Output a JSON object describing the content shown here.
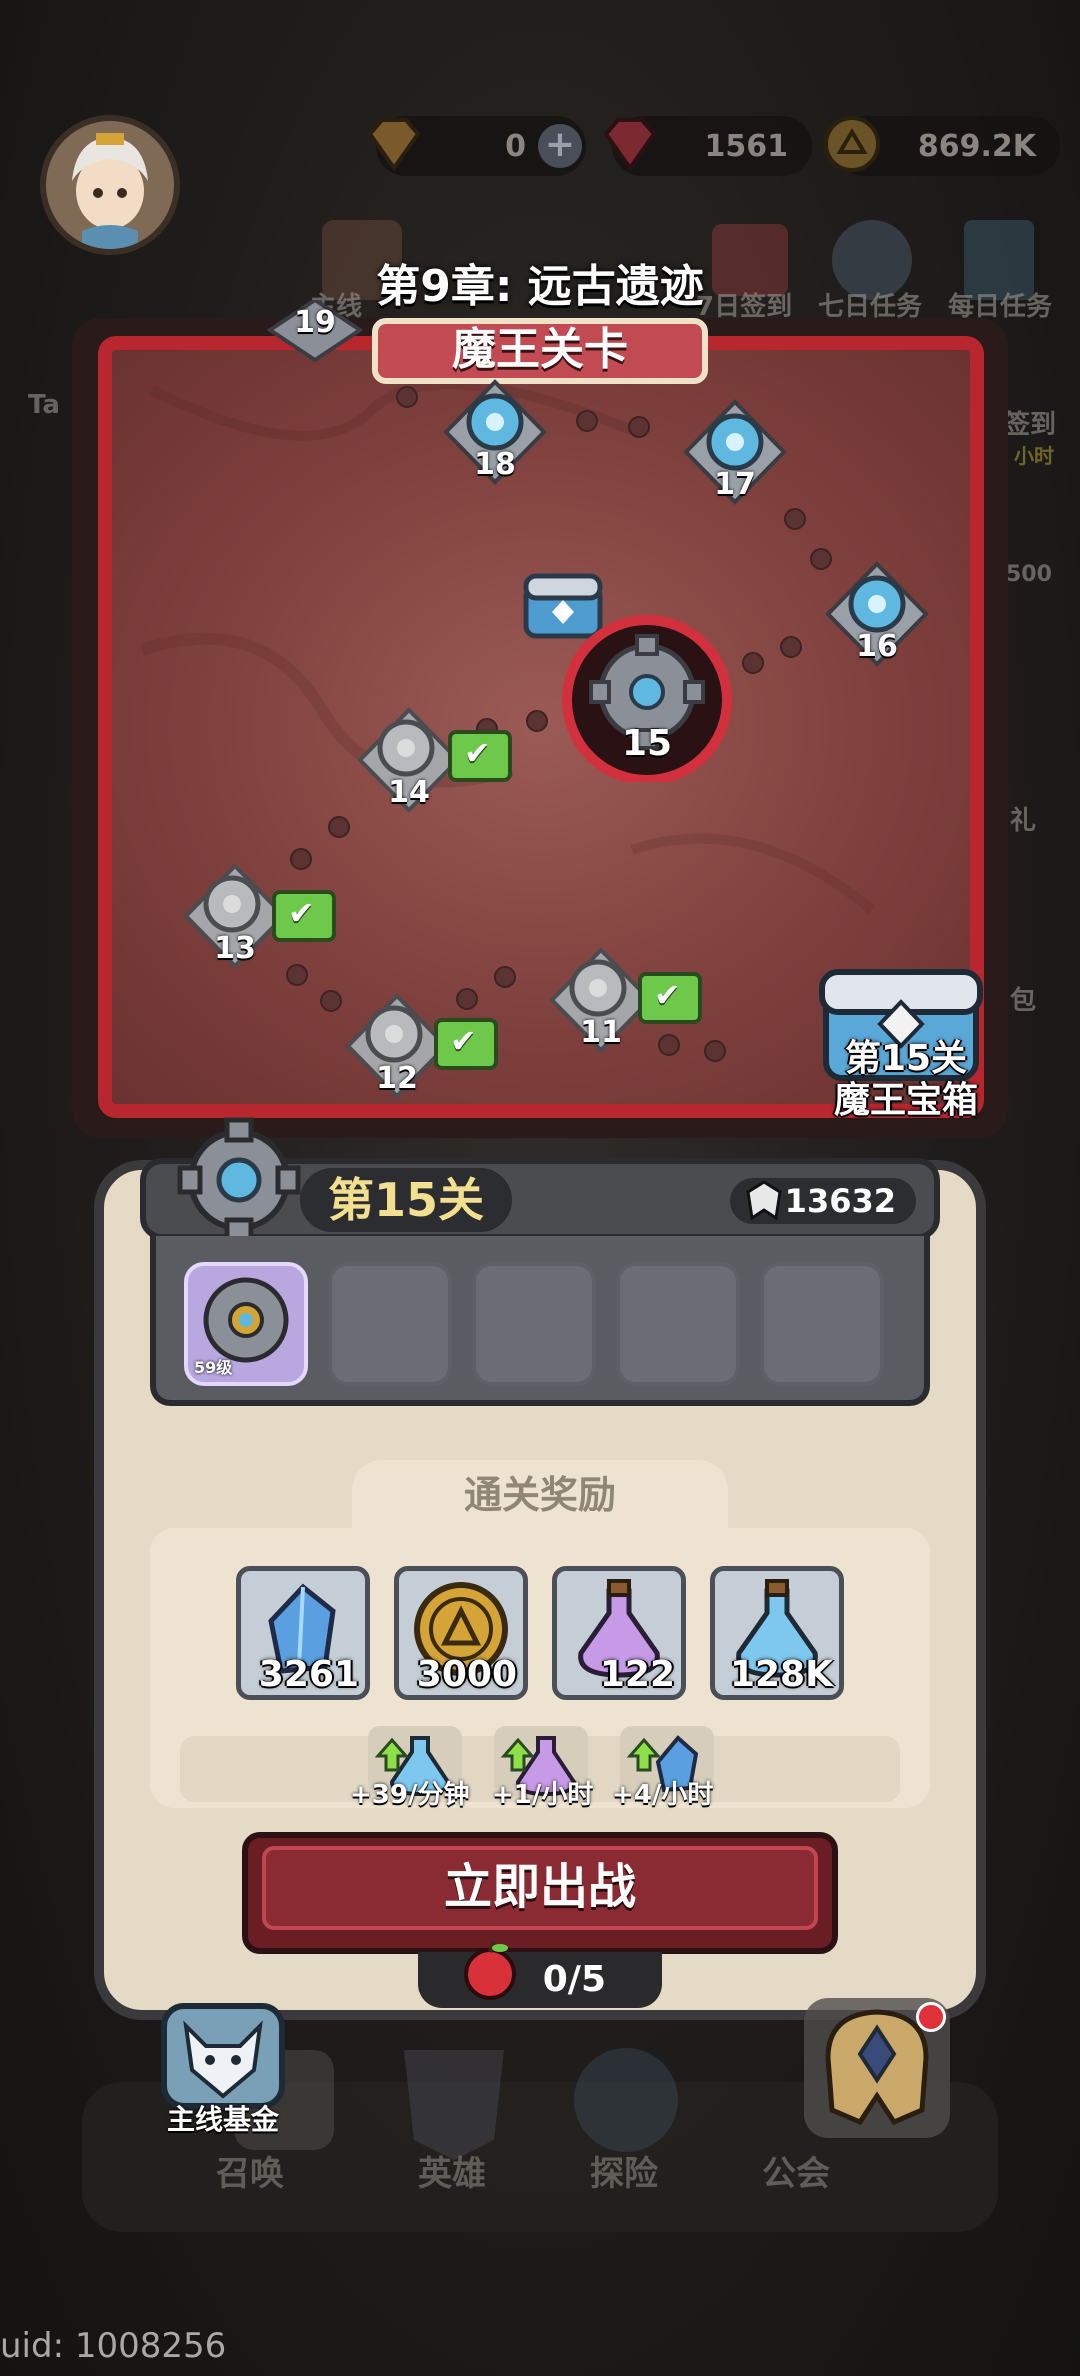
{
  "currency": {
    "diamond_value": "0",
    "ruby_value": "1561",
    "coin_value": "869.2K"
  },
  "top_menu": {
    "daily_task_label": "每日任务",
    "seven_day_task_label": "七日任务",
    "seven_day_signin_label": "7日签到",
    "mainline_label": "主线",
    "signin_label": "签到",
    "hours_label": "小时",
    "count_label": "500",
    "gift_label": "礼",
    "pack_label": "包",
    "tab_label": "Ta"
  },
  "chapter": {
    "title": "第9章: 远古遗迹",
    "banner": "魔王关卡"
  },
  "map": {
    "nodes": [
      {
        "number": "19"
      },
      {
        "number": "18"
      },
      {
        "number": "17"
      },
      {
        "number": "16"
      },
      {
        "number": "15"
      },
      {
        "number": "14"
      },
      {
        "number": "13"
      },
      {
        "number": "12"
      },
      {
        "number": "11"
      }
    ],
    "chest_label_line1": "第15关",
    "chest_label_line2": "魔王宝箱"
  },
  "stage": {
    "title": "第15关",
    "power": "13632",
    "hero_level": "59级"
  },
  "rewards": {
    "title": "通关奖励",
    "items": [
      {
        "name": "crystal",
        "count": "3261"
      },
      {
        "name": "coin",
        "count": "3000"
      },
      {
        "name": "purple-potion",
        "count": "122"
      },
      {
        "name": "blue-potion",
        "count": "128K"
      }
    ],
    "bonuses": [
      {
        "text": "+39/分钟"
      },
      {
        "text": "+1/小时"
      },
      {
        "text": "+4/小时"
      }
    ]
  },
  "actions": {
    "fight_label": "立即出战",
    "stamina": "0/5"
  },
  "side": {
    "fund_label": "主线基金"
  },
  "nav": {
    "summon": "召唤",
    "hero": "英雄",
    "explore": "探险",
    "guild": "公会"
  },
  "footer": {
    "uid": "uid: 1008256"
  },
  "colors": {
    "map_border": "#b8262e",
    "stage_title": "#f3df90",
    "fight_button": "#8a2b33",
    "check_flag": "#6ec84a"
  }
}
